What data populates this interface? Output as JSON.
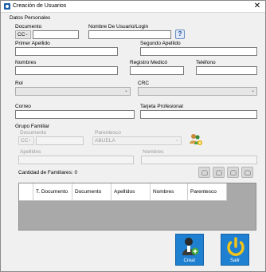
{
  "window": {
    "title": "Creación de Usuarios",
    "close_glyph": "✕"
  },
  "datos_personales": {
    "section_label": "Datos Personales",
    "documento_label": "Documento",
    "documento_tipo": "CC",
    "documento_value": "",
    "usuario_label": "Nombre De Usuario/Login",
    "usuario_value": "",
    "help_glyph": "?",
    "primer_apellido_label": "Primer Apellido",
    "primer_apellido_value": "",
    "segundo_apellido_label": "Segundo Apellido",
    "segundo_apellido_value": "",
    "nombres_label": "Nombres",
    "nombres_value": "",
    "registro_medico_label": "Registro Medicó",
    "registro_medico_value": "",
    "telefono_label": "Teléfono",
    "telefono_value": "",
    "rol_label": "Rol",
    "rol_value": "",
    "crc_label": "CRC",
    "crc_value": "",
    "correo_label": "Correo",
    "correo_value": "",
    "tarjeta_label": "Tarjeta Profesional",
    "tarjeta_value": ""
  },
  "grupo_familiar": {
    "section_label": "Grupo Familiar",
    "documento_label": "Documento",
    "documento_tipo": "CC",
    "documento_value": "",
    "parentesco_label": "Parentesco",
    "parentesco_value": "ABUELA",
    "apellidos_label": "Apellidos",
    "apellidos_value": "",
    "nombres_label": "Nombres",
    "nombres_value": "",
    "cantidad_label": "Cantidad de Familiares: 0",
    "grid_columns": [
      "",
      "T. Documento",
      "Documento",
      "Apellidos",
      "Nombres",
      "Parentesco"
    ]
  },
  "actions": {
    "crear_label": "Crear",
    "salir_label": "Salir"
  },
  "colors": {
    "action_button": "#1f7fd1",
    "title_icon": "#1c5fa8",
    "power_icon": "#f3c419"
  }
}
